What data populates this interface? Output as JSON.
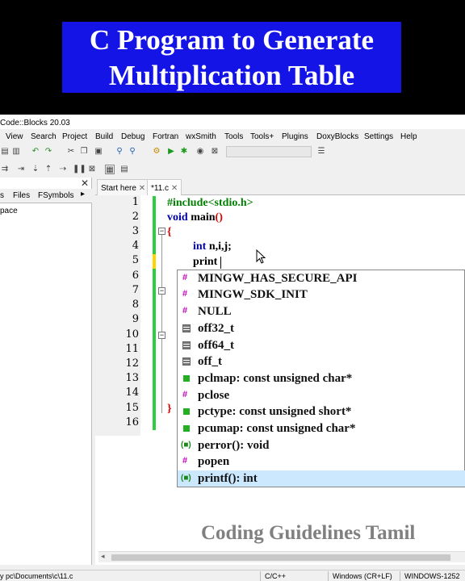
{
  "banner": {
    "title_line1": "C Program to Generate",
    "title_line2": "Multiplication Table"
  },
  "window": {
    "title": "Code::Blocks 20.03"
  },
  "menu": [
    "View",
    "Search",
    "Project",
    "Build",
    "Debug",
    "Fortran",
    "wxSmith",
    "Tools",
    "Tools+",
    "Plugins",
    "DoxyBlocks",
    "Settings",
    "Help"
  ],
  "left_panel": {
    "tabs": [
      "s",
      "Files",
      "FSymbols"
    ],
    "content": "pace"
  },
  "editor_tabs": [
    "Start here",
    "*11.c"
  ],
  "lines": [
    "1",
    "2",
    "3",
    "4",
    "5",
    "6",
    "7",
    "8",
    "9",
    "10",
    "11",
    "12",
    "13",
    "14",
    "15",
    "16"
  ],
  "code": {
    "l1": "#include<stdio.h>",
    "l2_kw": "void",
    "l2_fn": " main",
    "l2_paren": "()",
    "l3": "{",
    "l4_kw": "int",
    "l4_rest": " n,i,j;",
    "l5": "print",
    "l15": "}"
  },
  "autocomplete": {
    "items": [
      {
        "icon": "hash",
        "label": "MINGW_HAS_SECURE_API"
      },
      {
        "icon": "hash",
        "label": "MINGW_SDK_INIT"
      },
      {
        "icon": "hash",
        "label": "NULL"
      },
      {
        "icon": "typedef",
        "label": "off32_t"
      },
      {
        "icon": "typedef",
        "label": "off64_t"
      },
      {
        "icon": "typedef",
        "label": "off_t"
      },
      {
        "icon": "variable",
        "label": "pclmap: const unsigned char*"
      },
      {
        "icon": "hash",
        "label": "pclose"
      },
      {
        "icon": "variable",
        "label": "pctype: const unsigned short*"
      },
      {
        "icon": "variable",
        "label": "pcumap: const unsigned char*"
      },
      {
        "icon": "function",
        "label": "perror(): void"
      },
      {
        "icon": "hash",
        "label": "popen"
      },
      {
        "icon": "function",
        "label": "printf(): int"
      }
    ],
    "selected_index": 12
  },
  "status": {
    "path": "y pc\\Documents\\c\\11.c",
    "lang": "C/C++",
    "eol": "Windows (CR+LF)",
    "encoding": "WINDOWS-1252"
  },
  "watermark": "Coding Guidelines Tamil",
  "colors": {
    "banner_blue": "#1414e6",
    "code_green": "#008000",
    "keyword_blue": "#0000a0",
    "hash_magenta": "#c000c0",
    "typedef_gray": "#707070",
    "var_green": "#00a000",
    "change_green": "#2ecc40",
    "change_yellow": "#ffd400",
    "selection_blue": "#cce8ff"
  }
}
